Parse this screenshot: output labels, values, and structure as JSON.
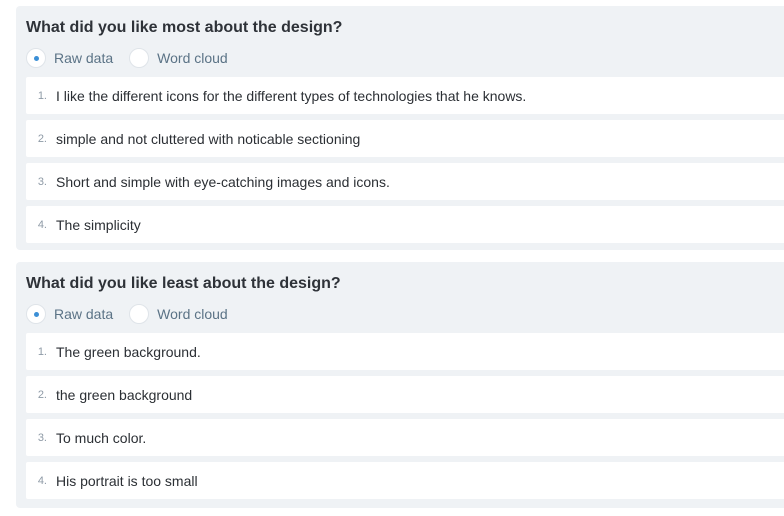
{
  "questions": [
    {
      "title": "What did you like most about the design?",
      "view_options": {
        "raw": "Raw data",
        "cloud": "Word cloud",
        "selected": "raw"
      },
      "answers": [
        {
          "num": "1.",
          "text": "I like the different icons for the different types of technologies that he knows."
        },
        {
          "num": "2.",
          "text": "simple and not cluttered with noticable sectioning"
        },
        {
          "num": "3.",
          "text": "Short and simple with eye-catching images and icons."
        },
        {
          "num": "4.",
          "text": "The simplicity"
        }
      ]
    },
    {
      "title": "What did you like least about the design?",
      "view_options": {
        "raw": "Raw data",
        "cloud": "Word cloud",
        "selected": "raw"
      },
      "answers": [
        {
          "num": "1.",
          "text": "The green background."
        },
        {
          "num": "2.",
          "text": "the green background"
        },
        {
          "num": "3.",
          "text": "To much color."
        },
        {
          "num": "4.",
          "text": "His portrait is too small"
        }
      ]
    }
  ],
  "colors": {
    "card_background": "#eff2f5",
    "radio_dot": "#3b8fd6",
    "label_text": "#5b7386"
  }
}
